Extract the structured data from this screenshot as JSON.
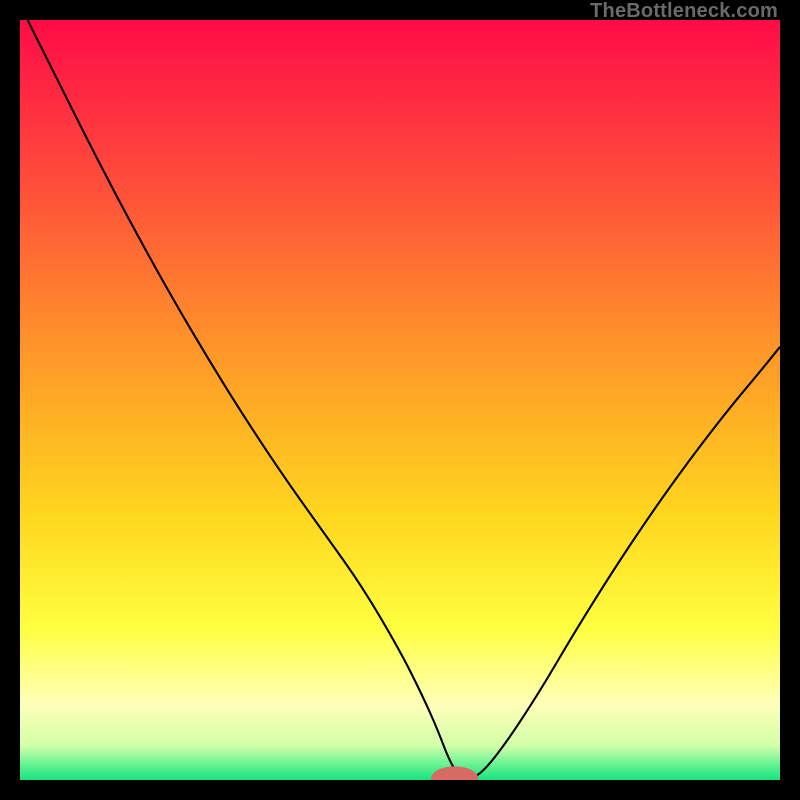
{
  "watermark": "TheBottleneck.com",
  "chart_data": {
    "type": "line",
    "title": "",
    "xlabel": "",
    "ylabel": "",
    "xlim": [
      0,
      100
    ],
    "ylim": [
      0,
      100
    ],
    "grid": false,
    "legend": false,
    "background_gradient": {
      "stops": [
        {
          "offset": 0.0,
          "color": "#ff0b47"
        },
        {
          "offset": 0.22,
          "color": "#ff4f3a"
        },
        {
          "offset": 0.45,
          "color": "#ff9b28"
        },
        {
          "offset": 0.65,
          "color": "#ffd61e"
        },
        {
          "offset": 0.8,
          "color": "#ffff40"
        },
        {
          "offset": 0.9,
          "color": "#ffffb9"
        },
        {
          "offset": 0.955,
          "color": "#d2ffa8"
        },
        {
          "offset": 0.975,
          "color": "#7af598"
        },
        {
          "offset": 1.0,
          "color": "#16e47e"
        }
      ]
    },
    "series": [
      {
        "name": "bottleneck-curve",
        "color": "#000000",
        "x": [
          1,
          5,
          10,
          15,
          20,
          25,
          30,
          35,
          40,
          45,
          50,
          53,
          55,
          56.5,
          58,
          60,
          63,
          68,
          73,
          78,
          83,
          88,
          93,
          98,
          100
        ],
        "y": [
          100,
          92,
          82,
          72.5,
          63.5,
          55,
          47,
          39.5,
          32.5,
          25.5,
          17,
          11,
          6.5,
          2.5,
          0.2,
          0.2,
          3.5,
          11,
          19.5,
          27.5,
          35,
          42,
          48.5,
          54.5,
          57
        ]
      }
    ],
    "marker": {
      "name": "optimal-point",
      "x": 57.2,
      "y": 0.2,
      "color": "#d76a63",
      "rx": 3.1,
      "ry": 1.6
    }
  }
}
